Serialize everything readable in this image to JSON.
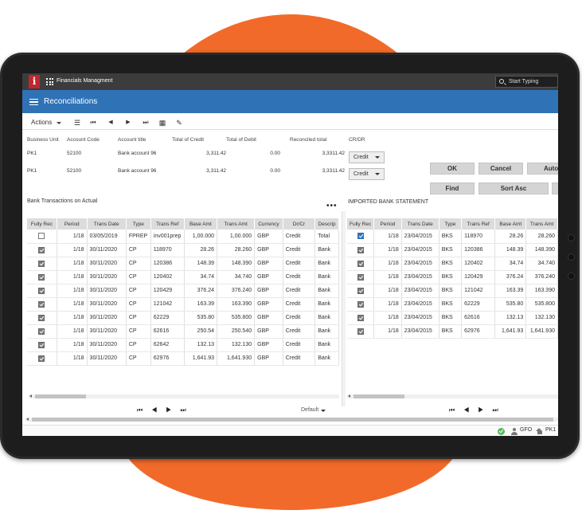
{
  "app": {
    "name": "Financials Managment",
    "search_placeholder": "Start Typing",
    "page_title": "Reconciliations"
  },
  "toolbar": {
    "actions_label": "Actions",
    "icons": [
      "list-icon",
      "first-page-icon",
      "prev-icon",
      "next-icon",
      "last-page-icon",
      "calculator-icon",
      "edit-icon"
    ]
  },
  "summary": {
    "headers": {
      "business_unit": "Business Unit",
      "account_code": "Account Code",
      "account_title": "Account title",
      "total_credit": "Total of Credit",
      "total_debit": "Total of Debit",
      "reconciled_total": "Reconciled total",
      "cr_dr": "CR/DR"
    },
    "rows": [
      {
        "business_unit": "PK1",
        "account_code": "52100",
        "account_title": "Bank account 96",
        "total_credit": "3,311.42",
        "total_debit": "0.00",
        "reconciled_total": "3,3311.42",
        "cr_dr": "Credit"
      },
      {
        "business_unit": "PK1",
        "account_code": "52100",
        "account_title": "Bank account 96",
        "total_credit": "3,311.42",
        "total_debit": "0.00",
        "reconciled_total": "3,3311.42",
        "cr_dr": "Credit"
      }
    ]
  },
  "buttons": {
    "ok": "OK",
    "cancel": "Cancel",
    "auto": "Auto",
    "find": "Find",
    "sort_asc": "Sort Asc"
  },
  "left_table": {
    "title": "Bank Transactions on Actual",
    "more": "•••",
    "columns": [
      "Fully Rec",
      "Period",
      "Trans Date",
      "Type",
      "Trans Ref",
      "Base Amt",
      "Trans Amt",
      "Currency",
      "Dr/Cr",
      "Descrip"
    ],
    "rows": [
      {
        "checked": false,
        "period": "1/18",
        "date": "03/05/2019",
        "type": "FPREP",
        "ref": "inv001prep",
        "base": "1,00.000",
        "trans": "1,00.000",
        "cur": "GBP",
        "drcr": "Credit",
        "desc": "Total"
      },
      {
        "checked": true,
        "period": "1/18",
        "date": "30/11/2020",
        "type": "CP",
        "ref": "118970",
        "base": "28.26",
        "trans": "28.260",
        "cur": "GBP",
        "drcr": "Credit",
        "desc": "Bank"
      },
      {
        "checked": true,
        "period": "1/18",
        "date": "30/11/2020",
        "type": "CP",
        "ref": "120386",
        "base": "148.39",
        "trans": "148.390",
        "cur": "GBP",
        "drcr": "Credit",
        "desc": "Bank"
      },
      {
        "checked": true,
        "period": "1/18",
        "date": "30/11/2020",
        "type": "CP",
        "ref": "120402",
        "base": "34.74",
        "trans": "34.740",
        "cur": "GBP",
        "drcr": "Credit",
        "desc": "Bank"
      },
      {
        "checked": true,
        "period": "1/18",
        "date": "30/11/2020",
        "type": "CP",
        "ref": "120429",
        "base": "376.24",
        "trans": "376.240",
        "cur": "GBP",
        "drcr": "Credit",
        "desc": "Bank"
      },
      {
        "checked": true,
        "period": "1/18",
        "date": "30/11/2020",
        "type": "CP",
        "ref": "121042",
        "base": "163.39",
        "trans": "163.390",
        "cur": "GBP",
        "drcr": "Credit",
        "desc": "Bank"
      },
      {
        "checked": true,
        "period": "1/18",
        "date": "30/11/2020",
        "type": "CP",
        "ref": "62229",
        "base": "535.80",
        "trans": "535.800",
        "cur": "GBP",
        "drcr": "Credit",
        "desc": "Bank"
      },
      {
        "checked": true,
        "period": "1/18",
        "date": "30/11/2020",
        "type": "CP",
        "ref": "62616",
        "base": "250.54",
        "trans": "250.540",
        "cur": "GBP",
        "drcr": "Credit",
        "desc": "Bank"
      },
      {
        "checked": true,
        "period": "1/18",
        "date": "30/11/2020",
        "type": "CP",
        "ref": "62642",
        "base": "132.13",
        "trans": "132.130",
        "cur": "GBP",
        "drcr": "Credit",
        "desc": "Bank"
      },
      {
        "checked": true,
        "period": "1/18",
        "date": "30/11/2020",
        "type": "CP",
        "ref": "62976",
        "base": "1,641.93",
        "trans": "1,641.930",
        "cur": "GBP",
        "drcr": "Credit",
        "desc": "Bank"
      }
    ]
  },
  "right_table": {
    "title": "IMPORTED BANK STATEMENT",
    "columns": [
      "Fully Rec",
      "Period",
      "Trans Date",
      "Type",
      "Trans Ref",
      "Base Amt",
      "Trans Amt"
    ],
    "rows": [
      {
        "checked": true,
        "period": "1/18",
        "date": "23/04/2015",
        "type": "BKS",
        "ref": "118970",
        "base": "28.26",
        "trans": "28.260"
      },
      {
        "checked": true,
        "period": "1/18",
        "date": "23/04/2015",
        "type": "BKS",
        "ref": "120386",
        "base": "148.39",
        "trans": "148.390"
      },
      {
        "checked": true,
        "period": "1/18",
        "date": "23/04/2015",
        "type": "BKS",
        "ref": "120402",
        "base": "34.74",
        "trans": "34.740"
      },
      {
        "checked": true,
        "period": "1/18",
        "date": "23/04/2015",
        "type": "BKS",
        "ref": "120429",
        "base": "376.24",
        "trans": "376.240"
      },
      {
        "checked": true,
        "period": "1/18",
        "date": "23/04/2015",
        "type": "BKS",
        "ref": "121042",
        "base": "163.39",
        "trans": "163.390"
      },
      {
        "checked": true,
        "period": "1/18",
        "date": "23/04/2015",
        "type": "BKS",
        "ref": "62229",
        "base": "535.80",
        "trans": "535.800"
      },
      {
        "checked": true,
        "period": "1/18",
        "date": "23/04/2015",
        "type": "BKS",
        "ref": "62616",
        "base": "132.13",
        "trans": "132.130"
      },
      {
        "checked": true,
        "period": "1/18",
        "date": "23/04/2015",
        "type": "BKS",
        "ref": "62976",
        "base": "1,641.93",
        "trans": "1,641.930"
      }
    ]
  },
  "pager": {
    "left": "⏮◀▶⏭",
    "right": "⏮◀▶⏭",
    "default_label": "Default"
  },
  "status_bar": {
    "user": "GFO",
    "unit": "PK1"
  },
  "colors": {
    "accent": "#2f73b6",
    "background_blob": "#f26a2a",
    "topbar": "#3c3c3c"
  }
}
